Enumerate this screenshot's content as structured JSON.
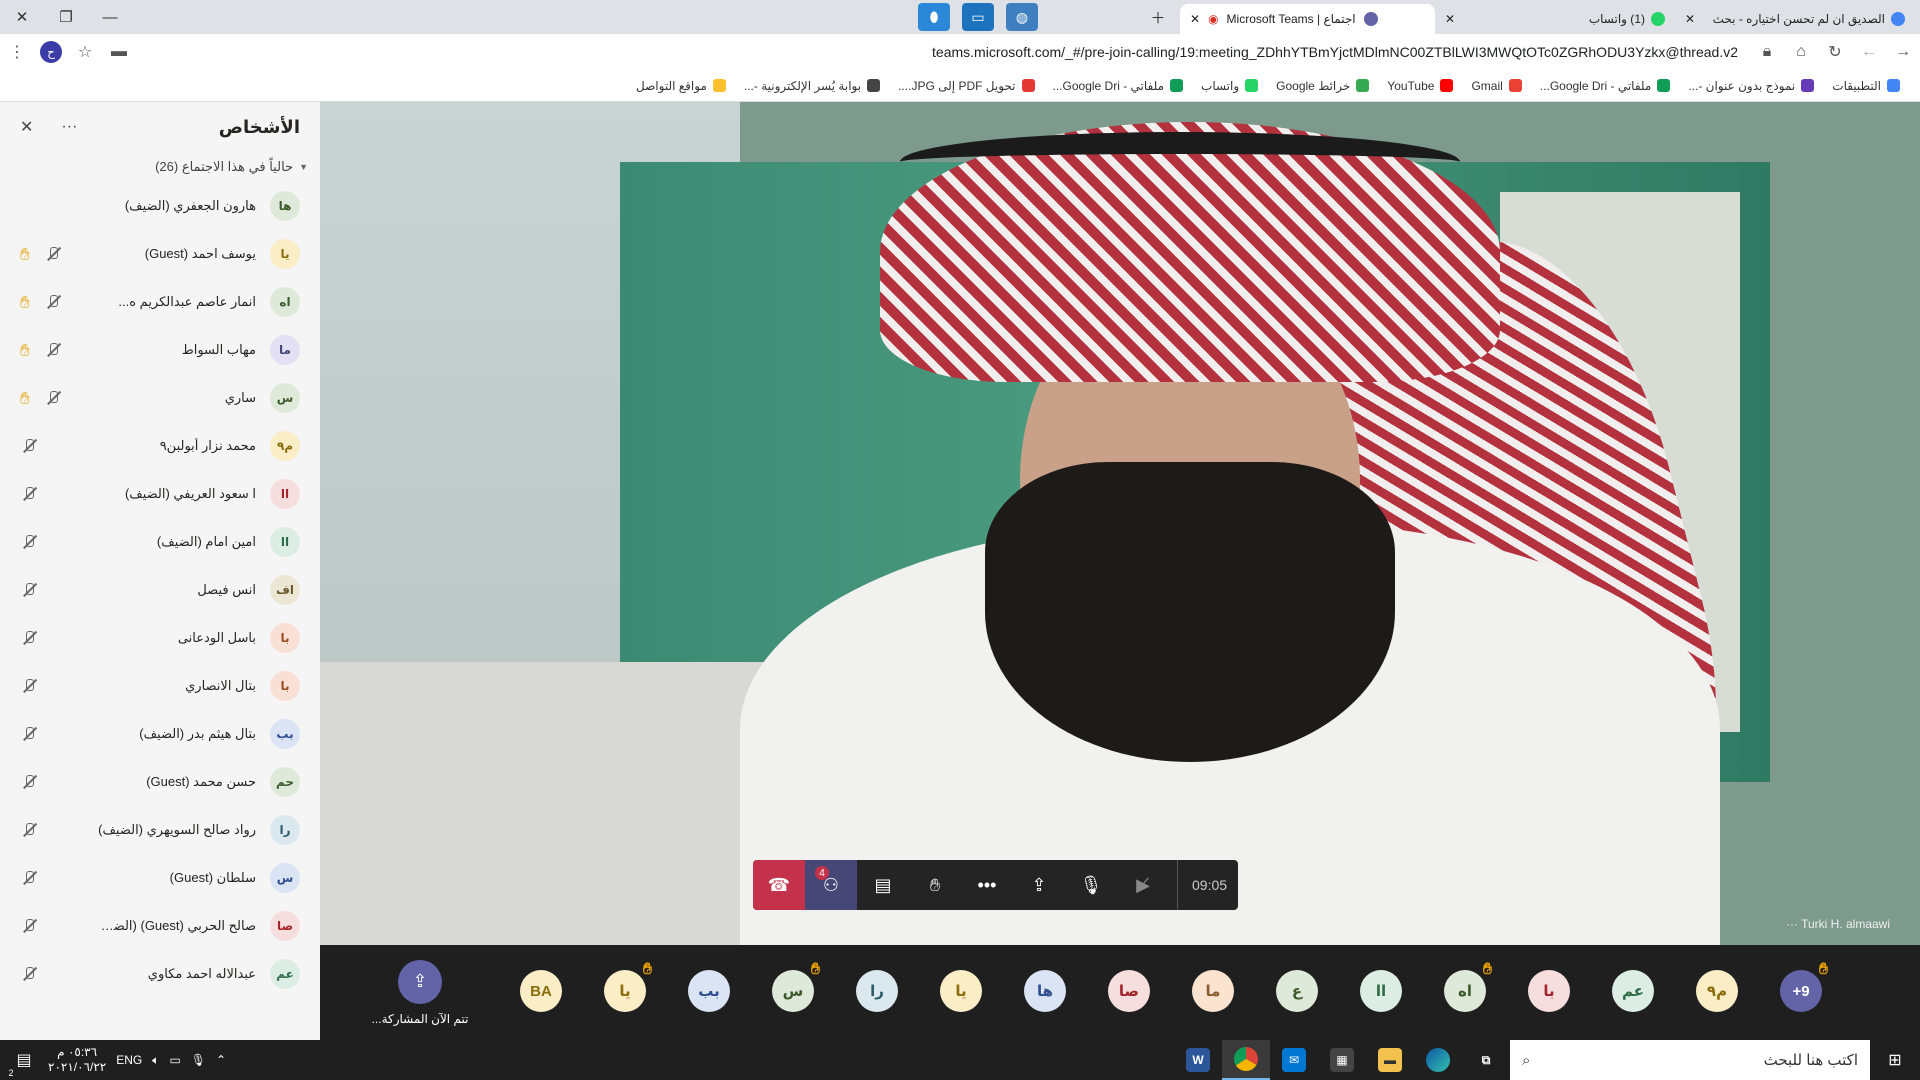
{
  "browser": {
    "tabs": [
      {
        "title": "الصديق ان لم تحسن اختياره - بحث",
        "active": false,
        "color": "#4285f4"
      },
      {
        "title": "(1) واتساب",
        "active": false,
        "color": "#25d366"
      },
      {
        "title": "اجتماع | Microsoft Teams",
        "active": true,
        "color": "#6264a7"
      }
    ],
    "url": "teams.microsoft.com/_#/pre-join-calling/19:meeting_ZDhhYTBmYjctMDlmNC00ZTBlLWI3MWQtOTc0ZGRhODU3Yzkx@thread.v2",
    "profile_initial": "ح",
    "bookmarks": [
      {
        "label": "التطبيقات",
        "color": "#4285f4"
      },
      {
        "label": "نموذج بدون عنوان -...",
        "color": "#673ab7"
      },
      {
        "label": "ملفاتي - Google Dri...",
        "color": "#0f9d58"
      },
      {
        "label": "Gmail",
        "color": "#ea4335"
      },
      {
        "label": "YouTube",
        "color": "#ff0000"
      },
      {
        "label": "خرائط Google",
        "color": "#34a853"
      },
      {
        "label": "واتساب",
        "color": "#25d366"
      },
      {
        "label": "ملفاتي - Google Dri...",
        "color": "#0f9d58"
      },
      {
        "label": "تحويل PDF إلى JPG....",
        "color": "#e53935"
      },
      {
        "label": "بوابة يُسر الإلكترونية -...",
        "color": "#444444"
      },
      {
        "label": "مواقع التواصل",
        "color": "#fbc02d"
      }
    ]
  },
  "people_panel": {
    "title": "الأشخاص",
    "section": "حالياً في هذا الاجتماع (26)",
    "participants": [
      {
        "initials": "ها",
        "name": "هارون الجعفري (الضيف)",
        "hand": false,
        "muted": false,
        "bg": "#dfe9d9",
        "fg": "#3d5c2e"
      },
      {
        "initials": "يا",
        "name": "يوسف احمد (Guest)",
        "hand": true,
        "muted": true,
        "bg": "#fbeec6",
        "fg": "#8a6d0b"
      },
      {
        "initials": "اه",
        "name": "انمار عاصم عبدالكريم ه...",
        "hand": true,
        "muted": true,
        "bg": "#dfe9d9",
        "fg": "#3d5c2e"
      },
      {
        "initials": "ما",
        "name": "مهاب السواط",
        "hand": true,
        "muted": true,
        "bg": "#e2e0f2",
        "fg": "#464775"
      },
      {
        "initials": "س",
        "name": "ساري",
        "hand": true,
        "muted": true,
        "bg": "#dfe9d9",
        "fg": "#3d5c2e"
      },
      {
        "initials": "م٩",
        "name": "محمد نزار أبولبن٩",
        "hand": false,
        "muted": true,
        "bg": "#fbeec6",
        "fg": "#8a6d0b"
      },
      {
        "initials": "اا",
        "name": "ا سعود العريفي (الضيف)",
        "hand": false,
        "muted": true,
        "bg": "#f7dede",
        "fg": "#a4262c"
      },
      {
        "initials": "اا",
        "name": "امين امام (الضيف)",
        "hand": false,
        "muted": true,
        "bg": "#dceee3",
        "fg": "#2e6b47"
      },
      {
        "initials": "اف",
        "name": "انس فيصل",
        "hand": false,
        "muted": true,
        "bg": "#ece6d5",
        "fg": "#6b5a2e"
      },
      {
        "initials": "با",
        "name": "باسل الودعانى",
        "hand": false,
        "muted": true,
        "bg": "#f9e0d6",
        "fg": "#a14a1e"
      },
      {
        "initials": "با",
        "name": "بتال الانصاري",
        "hand": false,
        "muted": true,
        "bg": "#f9e0d6",
        "fg": "#a14a1e"
      },
      {
        "initials": "بب",
        "name": "بتال هيثم بدر (الضيف)",
        "hand": false,
        "muted": true,
        "bg": "#dbe4f5",
        "fg": "#2f4f8f"
      },
      {
        "initials": "حم",
        "name": "حسن محمد (Guest)",
        "hand": false,
        "muted": true,
        "bg": "#dfe9d9",
        "fg": "#3d5c2e"
      },
      {
        "initials": "را",
        "name": "رواد صالح السويهري (الضيف)",
        "hand": false,
        "muted": true,
        "bg": "#dbe9ef",
        "fg": "#2e5c6b"
      },
      {
        "initials": "س",
        "name": "سلطان (Guest)",
        "hand": false,
        "muted": true,
        "bg": "#dbe4f5",
        "fg": "#2f4f8f"
      },
      {
        "initials": "صا",
        "name": "صالح الحربي (Guest) (الضيف)",
        "hand": false,
        "muted": true,
        "bg": "#f7dede",
        "fg": "#a4262c"
      },
      {
        "initials": "عم",
        "name": "عبدالاله احمد مكاوي",
        "hand": false,
        "muted": true,
        "bg": "#dceee3",
        "fg": "#2e6b47"
      }
    ]
  },
  "video": {
    "speaker_name": "Turki H. almaawi"
  },
  "controls": {
    "people_badge": "4",
    "timer": "09:05"
  },
  "strip": {
    "share_label": "تتم الآن المشاركة...",
    "bubbles": [
      {
        "initials": "BA",
        "bg": "#fbeec6",
        "fg": "#8a6d0b",
        "hand": false
      },
      {
        "initials": "يا",
        "bg": "#fbeec6",
        "fg": "#8a6d0b",
        "hand": true
      },
      {
        "initials": "بب",
        "bg": "#dbe4f5",
        "fg": "#2f4f8f",
        "hand": false
      },
      {
        "initials": "س",
        "bg": "#dfe9d9",
        "fg": "#3d5c2e",
        "hand": true
      },
      {
        "initials": "را",
        "bg": "#dbe9ef",
        "fg": "#2e5c6b",
        "hand": false
      },
      {
        "initials": "يا",
        "bg": "#fbeec6",
        "fg": "#8a6d0b",
        "hand": false
      },
      {
        "initials": "ها",
        "bg": "#dbe4f5",
        "fg": "#2f4f8f",
        "hand": false
      },
      {
        "initials": "صا",
        "bg": "#f7dede",
        "fg": "#a4262c",
        "hand": false
      },
      {
        "initials": "ما",
        "bg": "#fbe3cf",
        "fg": "#8a5a2e",
        "hand": false
      },
      {
        "initials": "ع",
        "bg": "#dfe9d9",
        "fg": "#3d5c2e",
        "hand": false
      },
      {
        "initials": "اا",
        "bg": "#dceee3",
        "fg": "#2e6b47",
        "hand": false
      },
      {
        "initials": "اه",
        "bg": "#dfe9d9",
        "fg": "#3d5c2e",
        "hand": true
      },
      {
        "initials": "با",
        "bg": "#f7dede",
        "fg": "#a4262c",
        "hand": false
      },
      {
        "initials": "عم",
        "bg": "#dceee3",
        "fg": "#2e6b47",
        "hand": false
      },
      {
        "initials": "م٩",
        "bg": "#fbeec6",
        "fg": "#8a6d0b",
        "hand": false
      },
      {
        "initials": "+9",
        "bg": "#6264a7",
        "fg": "#ffffff",
        "hand": true
      }
    ]
  },
  "taskbar": {
    "search_placeholder": "اكتب هنا للبحث",
    "lang": "ENG",
    "time": "٠٥:٣٦ م",
    "date": "٢٠٢١/٠٦/٢٢",
    "notification_count": "2"
  }
}
